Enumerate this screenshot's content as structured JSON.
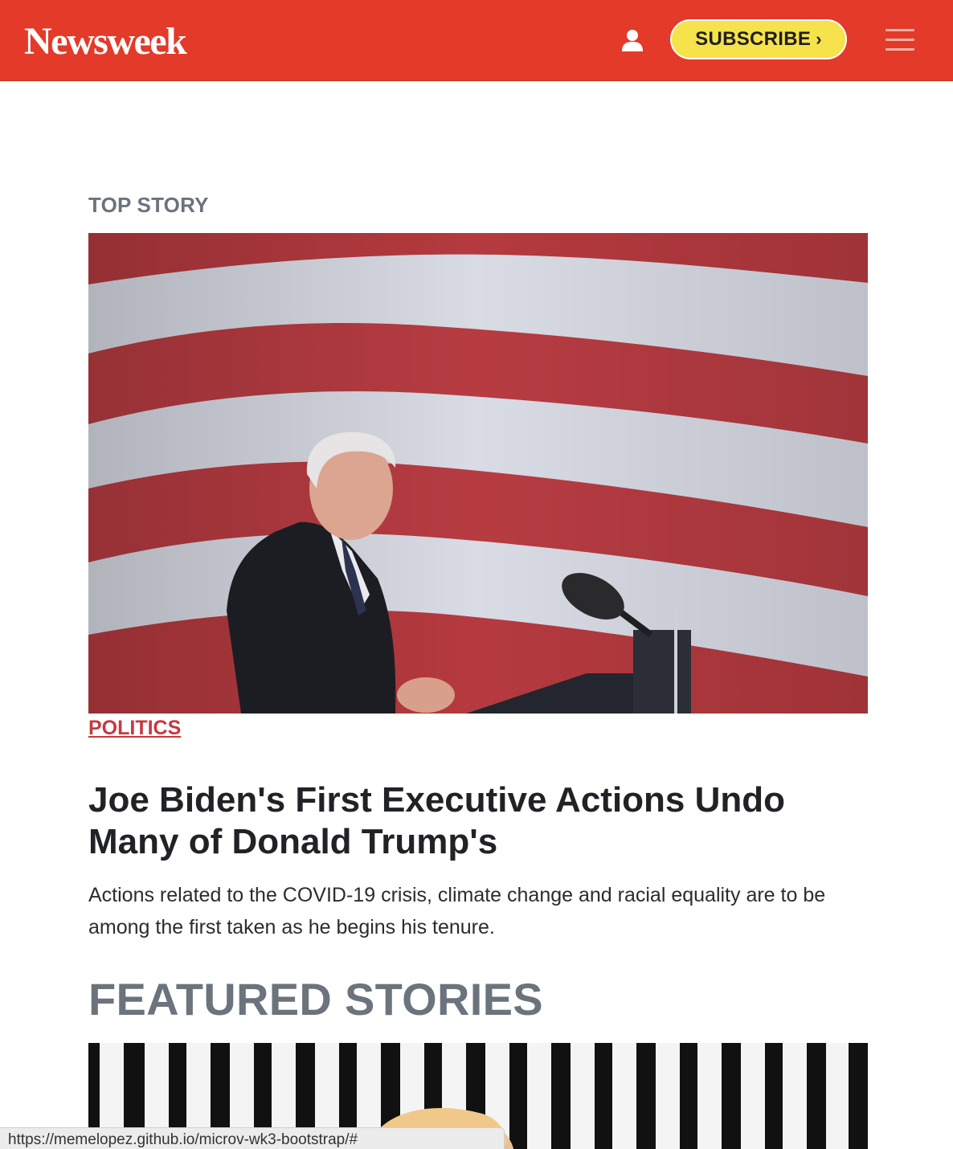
{
  "header": {
    "logo": "Newsweek",
    "subscribe_label": "SUBSCRIBE",
    "subscribe_chevron": "›",
    "colors": {
      "bar": "#e33a29",
      "subscribe": "#f6e24a"
    },
    "icons": [
      "user-icon",
      "hamburger-menu-icon"
    ]
  },
  "top_story": {
    "section_label": "TOP STORY",
    "category": "POLITICS",
    "headline": "Joe Biden's First Executive Actions Undo Many of Donald Trump's",
    "summary": "Actions related to the COVID-19 crisis, climate change and racial equality are to be among the first taken as he begins his tenure."
  },
  "featured": {
    "heading": "FEATURED STORIES"
  },
  "status_bar": {
    "url": "https://memelopez.github.io/microv-wk3-bootstrap/#"
  }
}
